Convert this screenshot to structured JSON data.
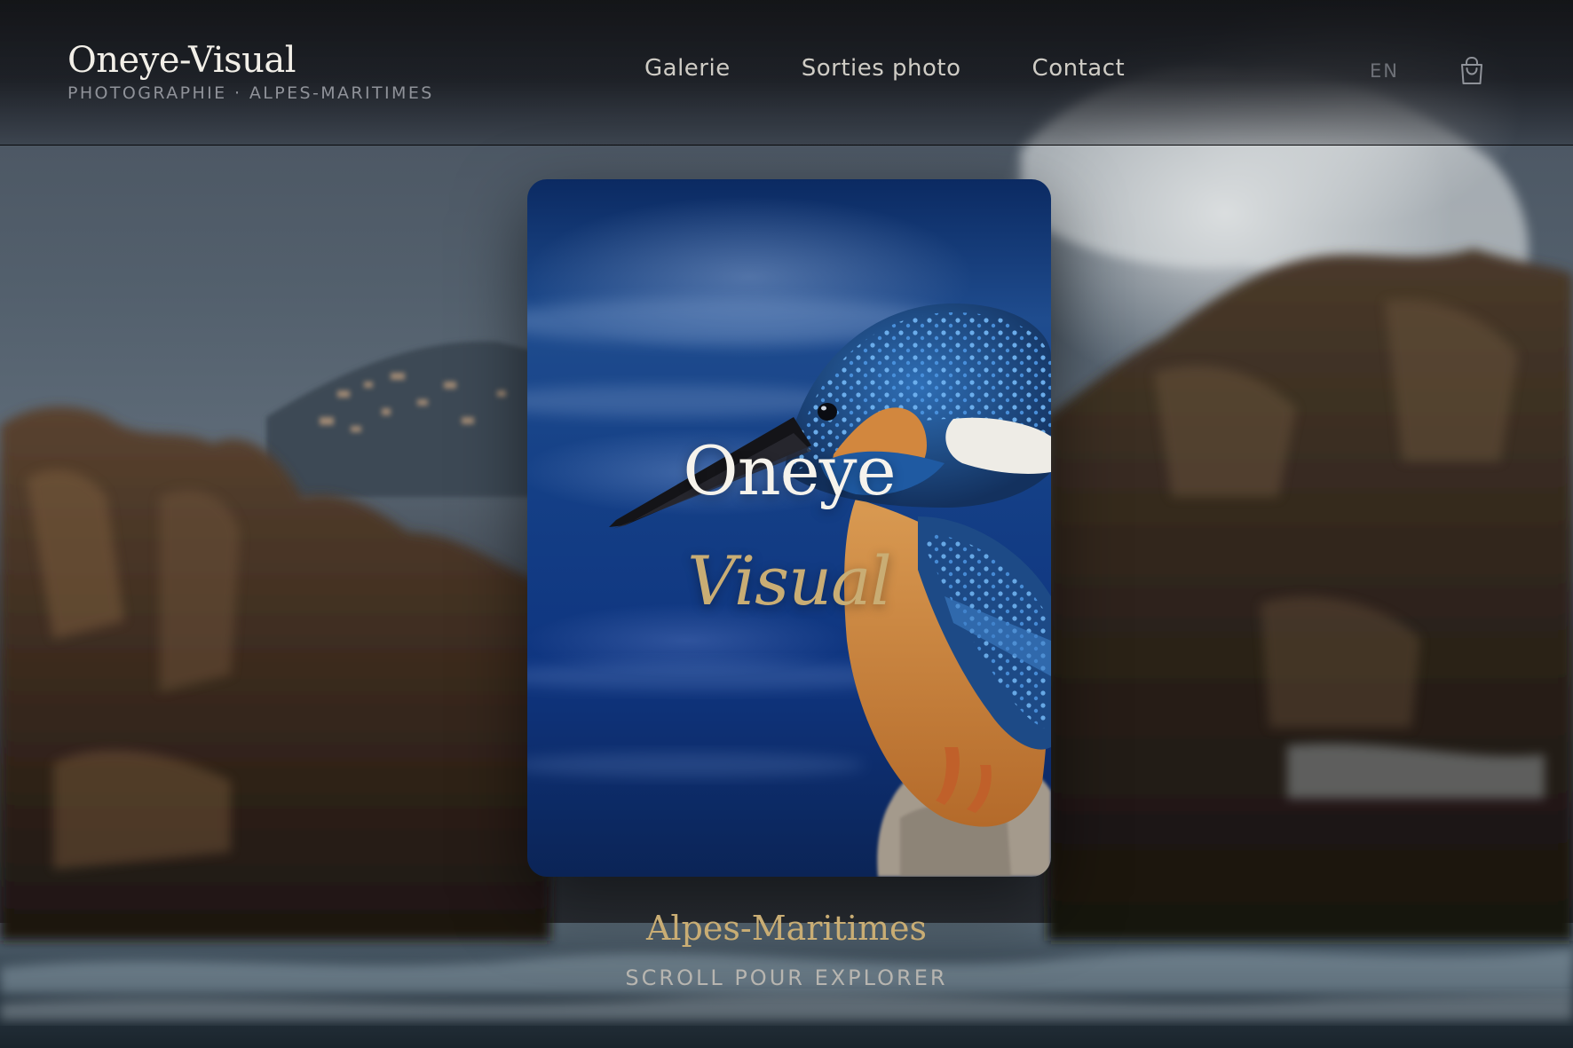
{
  "header": {
    "brand_title": "Oneye-Visual",
    "brand_subtitle": "PHOTOGRAPHIE · ALPES-MARITIMES",
    "nav": [
      {
        "label": "Galerie"
      },
      {
        "label": "Sorties photo"
      },
      {
        "label": "Contact"
      }
    ],
    "language": "EN",
    "cart_icon": "shopping-bag-icon"
  },
  "hero": {
    "title_line1": "Oneye",
    "title_line2": "Visual",
    "region": "Alpes-Maritimes",
    "scroll_hint": "SCROLL POUR EXPLORER"
  },
  "colors": {
    "accent_gold": "#c9ad74",
    "text_light": "#f2efe8",
    "nav_text": "#cfccc5",
    "muted": "#8f9299"
  }
}
